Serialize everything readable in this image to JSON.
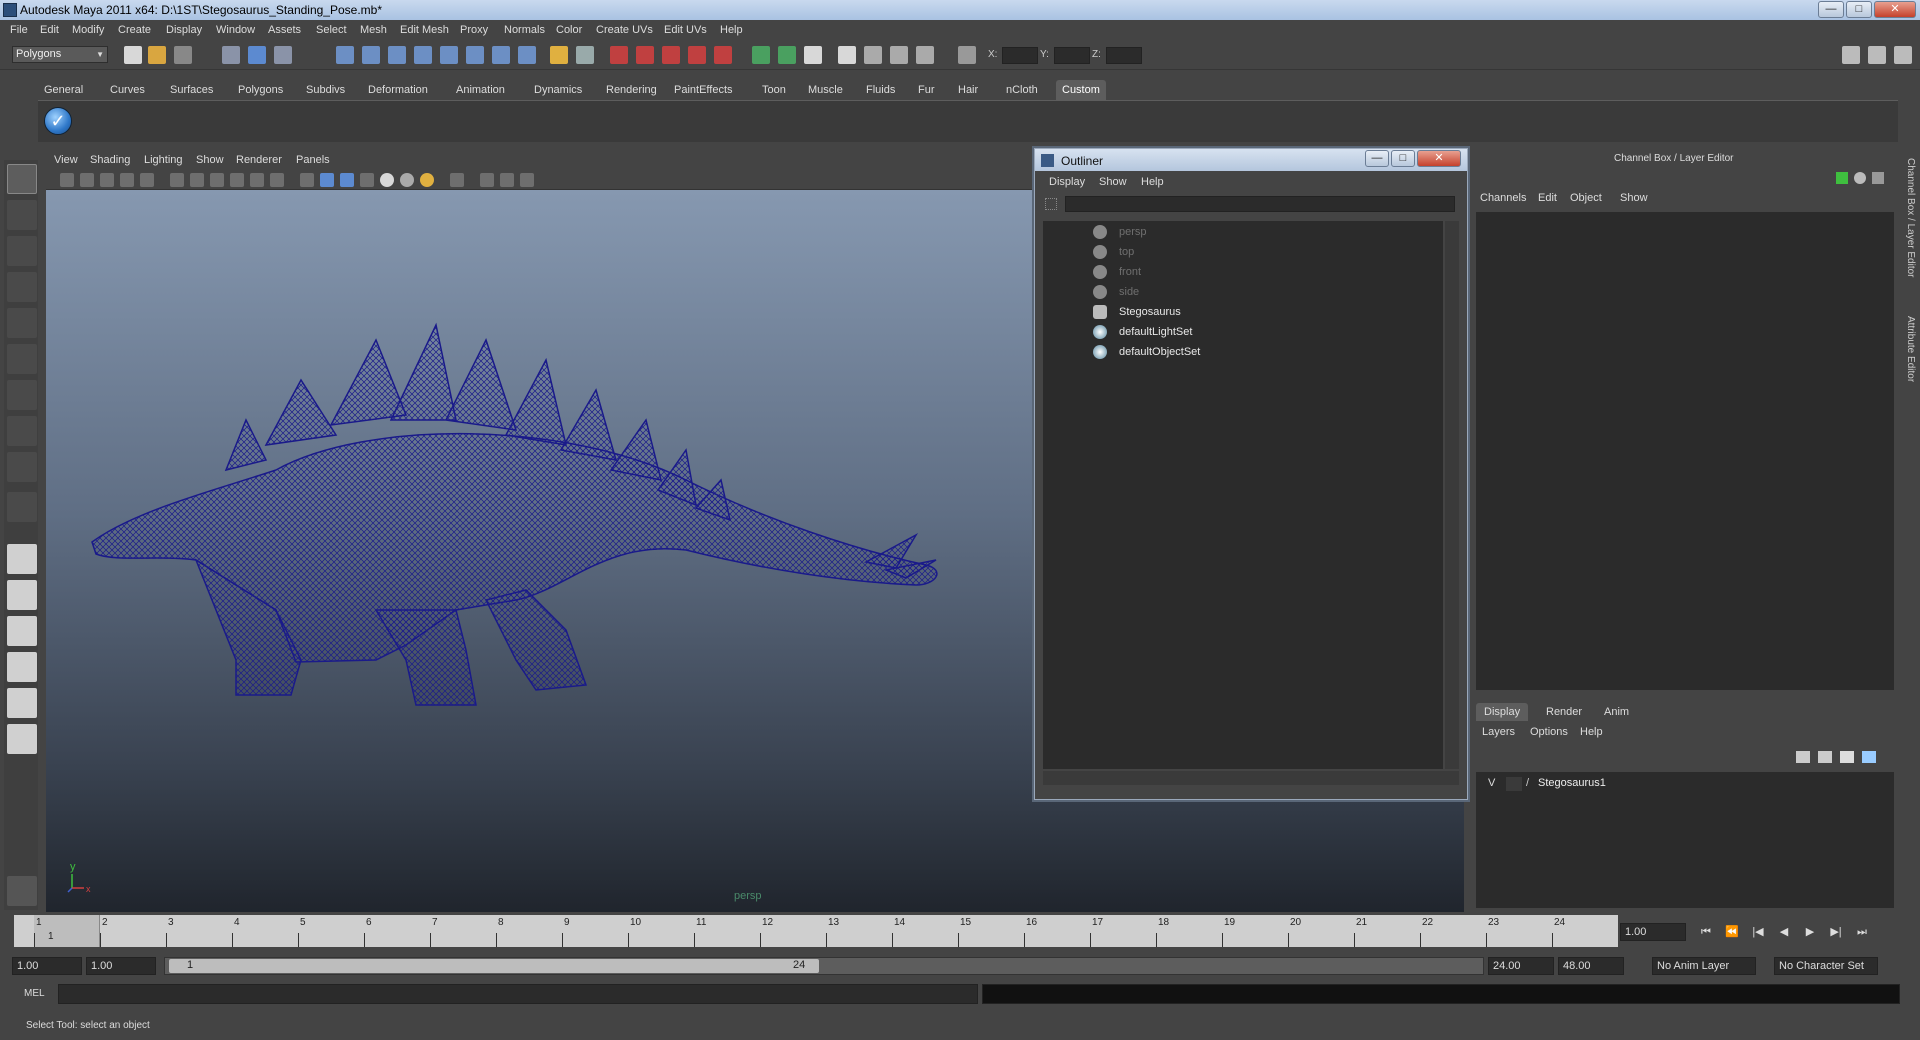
{
  "window": {
    "title": "Autodesk Maya 2011 x64: D:\\1ST\\Stegosaurus_Standing_Pose.mb*",
    "min_label": "—",
    "max_label": "□",
    "close_label": "✕"
  },
  "menubar": {
    "items": [
      "File",
      "Edit",
      "Modify",
      "Create",
      "Display",
      "Window",
      "Assets",
      "Select",
      "Mesh",
      "Edit Mesh",
      "Proxy",
      "Normals",
      "Color",
      "Create UVs",
      "Edit UVs",
      "Help"
    ]
  },
  "statusline": {
    "mode": "Polygons",
    "x_label": "X:",
    "y_label": "Y:",
    "z_label": "Z:"
  },
  "shelf": {
    "tabs": [
      "General",
      "Curves",
      "Surfaces",
      "Polygons",
      "Subdivs",
      "Deformation",
      "Animation",
      "Dynamics",
      "Rendering",
      "PaintEffects",
      "Toon",
      "Muscle",
      "Fluids",
      "Fur",
      "Hair",
      "nCloth",
      "Custom"
    ],
    "active_tab": "Custom",
    "check_icon": "✓"
  },
  "viewport": {
    "menus": [
      "View",
      "Shading",
      "Lighting",
      "Show",
      "Renderer",
      "Panels"
    ],
    "camera_label": "persp",
    "axis_y": "y",
    "axis_x": "x",
    "wire_color": "#1a1a8a"
  },
  "outliner": {
    "title": "Outliner",
    "menus": [
      "Display",
      "Show",
      "Help"
    ],
    "items": [
      {
        "label": "persp",
        "icon": "camera-icon",
        "dim": true
      },
      {
        "label": "top",
        "icon": "camera-icon",
        "dim": true
      },
      {
        "label": "front",
        "icon": "camera-icon",
        "dim": true
      },
      {
        "label": "side",
        "icon": "camera-icon",
        "dim": true
      },
      {
        "label": "Stegosaurus",
        "icon": "mesh-icon",
        "dim": false
      },
      {
        "label": "defaultLightSet",
        "icon": "set-icon",
        "dim": false
      },
      {
        "label": "defaultObjectSet",
        "icon": "set-icon",
        "dim": false
      }
    ]
  },
  "channelbox": {
    "title": "Channel Box / Layer Editor",
    "menus": [
      "Channels",
      "Edit",
      "Object",
      "Show"
    ],
    "side_tabs": [
      "Channel Box / Layer Editor",
      "Attribute Editor"
    ]
  },
  "layer_editor": {
    "tabs": [
      "Display",
      "Render",
      "Anim"
    ],
    "active_tab": "Display",
    "menus": [
      "Layers",
      "Options",
      "Help"
    ],
    "layer": {
      "visible": "V",
      "name": "Stegosaurus1"
    }
  },
  "timeslider": {
    "ticks": [
      "1",
      "2",
      "3",
      "4",
      "5",
      "6",
      "7",
      "8",
      "9",
      "10",
      "11",
      "12",
      "13",
      "14",
      "15",
      "16",
      "17",
      "18",
      "19",
      "20",
      "21",
      "22",
      "23",
      "24"
    ],
    "current_frame_label": "1",
    "current_time": "1.00",
    "playback": [
      "⏮",
      "⏪",
      "|◀",
      "◀",
      "▶",
      "▶|",
      "⏭"
    ]
  },
  "rangebar": {
    "start": "1.00",
    "start2": "1.00",
    "thumb_start": "1",
    "thumb_end": "24",
    "end": "24.00",
    "end2": "48.00",
    "anim_layer": "No Anim Layer",
    "char_set": "No Character Set"
  },
  "cmdline": {
    "label": "MEL"
  },
  "helpline": {
    "text": "Select Tool: select an object"
  }
}
